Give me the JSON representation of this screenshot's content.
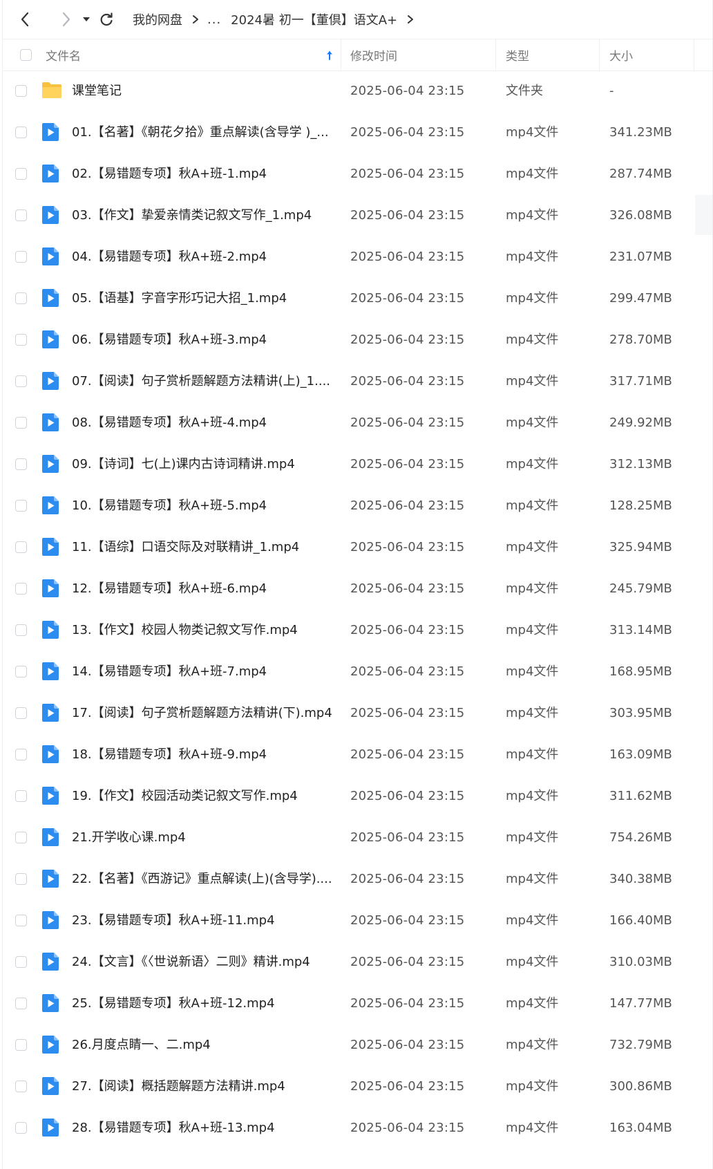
{
  "breadcrumb": {
    "root": "我的网盘",
    "ellipsis": "...",
    "current": "2024暑 初一【董倶】语文A+"
  },
  "columns": {
    "name": "文件名",
    "modified": "修改时间",
    "type": "类型",
    "size": "大小"
  },
  "sort_icon": "arrow-up-icon",
  "colors": {
    "accent": "#1677ff",
    "folder": "#f7c13f",
    "video": "#2d8cf0"
  },
  "files": [
    {
      "icon": "folder-icon",
      "name": "课堂笔记",
      "modified": "2025-06-04 23:15",
      "type": "文件夹",
      "size": "-"
    },
    {
      "icon": "video-file-icon",
      "name": "01.【名著】《朝花夕拾》重点解读(含导学 )_...",
      "modified": "2025-06-04 23:15",
      "type": "mp4文件",
      "size": "341.23MB"
    },
    {
      "icon": "video-file-icon",
      "name": "02.【易错题专项】秋A+班-1.mp4",
      "modified": "2025-06-04 23:15",
      "type": "mp4文件",
      "size": "287.74MB"
    },
    {
      "icon": "video-file-icon",
      "name": "03.【作文】挚爱亲情类记叙文写作_1.mp4",
      "modified": "2025-06-04 23:15",
      "type": "mp4文件",
      "size": "326.08MB"
    },
    {
      "icon": "video-file-icon",
      "name": "04.【易错题专项】秋A+班-2.mp4",
      "modified": "2025-06-04 23:15",
      "type": "mp4文件",
      "size": "231.07MB"
    },
    {
      "icon": "video-file-icon",
      "name": "05.【语基】字音字形巧记大招_1.mp4",
      "modified": "2025-06-04 23:15",
      "type": "mp4文件",
      "size": "299.47MB"
    },
    {
      "icon": "video-file-icon",
      "name": "06.【易错题专项】秋A+班-3.mp4",
      "modified": "2025-06-04 23:15",
      "type": "mp4文件",
      "size": "278.70MB"
    },
    {
      "icon": "video-file-icon",
      "name": "07.【阅读】句子赏析题解题方法精讲(上)_1....",
      "modified": "2025-06-04 23:15",
      "type": "mp4文件",
      "size": "317.71MB"
    },
    {
      "icon": "video-file-icon",
      "name": "08.【易错题专项】秋A+班-4.mp4",
      "modified": "2025-06-04 23:15",
      "type": "mp4文件",
      "size": "249.92MB"
    },
    {
      "icon": "video-file-icon",
      "name": "09.【诗词】七(上)课内古诗词精讲.mp4",
      "modified": "2025-06-04 23:15",
      "type": "mp4文件",
      "size": "312.13MB"
    },
    {
      "icon": "video-file-icon",
      "name": "10.【易错题专项】秋A+班-5.mp4",
      "modified": "2025-06-04 23:15",
      "type": "mp4文件",
      "size": "128.25MB"
    },
    {
      "icon": "video-file-icon",
      "name": "11.【语综】口语交际及对联精讲_1.mp4",
      "modified": "2025-06-04 23:15",
      "type": "mp4文件",
      "size": "325.94MB"
    },
    {
      "icon": "video-file-icon",
      "name": "12.【易错题专项】秋A+班-6.mp4",
      "modified": "2025-06-04 23:15",
      "type": "mp4文件",
      "size": "245.79MB"
    },
    {
      "icon": "video-file-icon",
      "name": "13.【作文】校园人物类记叙文写作.mp4",
      "modified": "2025-06-04 23:15",
      "type": "mp4文件",
      "size": "313.14MB"
    },
    {
      "icon": "video-file-icon",
      "name": "14.【易错题专项】秋A+班-7.mp4",
      "modified": "2025-06-04 23:15",
      "type": "mp4文件",
      "size": "168.95MB"
    },
    {
      "icon": "video-file-icon",
      "name": "17.【阅读】句子赏析题解题方法精讲(下).mp4",
      "modified": "2025-06-04 23:15",
      "type": "mp4文件",
      "size": "303.95MB"
    },
    {
      "icon": "video-file-icon",
      "name": "18.【易错题专项】秋A+班-9.mp4",
      "modified": "2025-06-04 23:15",
      "type": "mp4文件",
      "size": "163.09MB"
    },
    {
      "icon": "video-file-icon",
      "name": "19.【作文】校园活动类记叙文写作.mp4",
      "modified": "2025-06-04 23:15",
      "type": "mp4文件",
      "size": "311.62MB"
    },
    {
      "icon": "video-file-icon",
      "name": "21.开学收心课.mp4",
      "modified": "2025-06-04 23:15",
      "type": "mp4文件",
      "size": "754.26MB"
    },
    {
      "icon": "video-file-icon",
      "name": "22.【名著】《西游记》重点解读(上)(含导学)....",
      "modified": "2025-06-04 23:15",
      "type": "mp4文件",
      "size": "340.38MB"
    },
    {
      "icon": "video-file-icon",
      "name": "23.【易错题专项】秋A+班-11.mp4",
      "modified": "2025-06-04 23:15",
      "type": "mp4文件",
      "size": "166.40MB"
    },
    {
      "icon": "video-file-icon",
      "name": "24.【文言】《〈世说新语〉二则》精讲.mp4",
      "modified": "2025-06-04 23:15",
      "type": "mp4文件",
      "size": "310.03MB"
    },
    {
      "icon": "video-file-icon",
      "name": "25.【易错题专项】秋A+班-12.mp4",
      "modified": "2025-06-04 23:15",
      "type": "mp4文件",
      "size": "147.77MB"
    },
    {
      "icon": "video-file-icon",
      "name": "26.月度点睛一、二.mp4",
      "modified": "2025-06-04 23:15",
      "type": "mp4文件",
      "size": "732.79MB"
    },
    {
      "icon": "video-file-icon",
      "name": "27.【阅读】概括题解题方法精讲.mp4",
      "modified": "2025-06-04 23:15",
      "type": "mp4文件",
      "size": "300.86MB"
    },
    {
      "icon": "video-file-icon",
      "name": "28.【易错题专项】秋A+班-13.mp4",
      "modified": "2025-06-04 23:15",
      "type": "mp4文件",
      "size": "163.04MB"
    }
  ]
}
